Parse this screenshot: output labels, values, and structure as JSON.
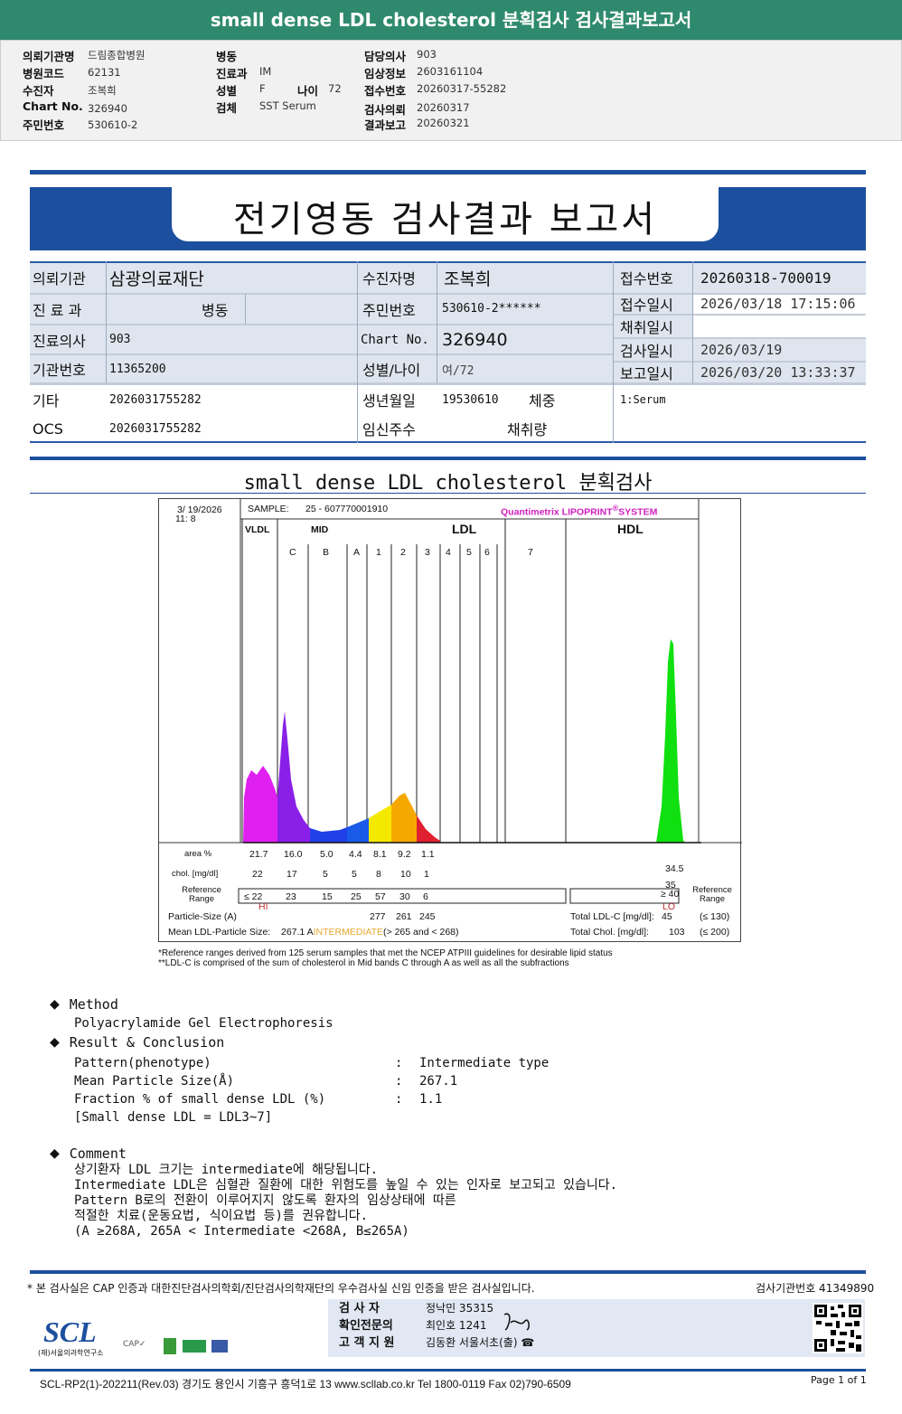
{
  "top_title": "small dense LDL cholesterol 분획검사 검사결과보고서",
  "header": {
    "hospital_label": "의뢰기관명",
    "hospital": "드림종합병원",
    "code_label": "병원코드",
    "code": "62131",
    "patient_label": "수진자",
    "patient": "조복희",
    "chart_label": "Chart No.",
    "chart": "326940",
    "id_label": "주민번호",
    "id": "530610-2",
    "ward_label": "병동",
    "ward": "",
    "dept_label": "진료과",
    "dept": "IM",
    "sex_label": "성별",
    "sex": "F",
    "age_label": "나이",
    "age": "72",
    "specimen_label": "검체",
    "specimen": "SST Serum",
    "doctor_label": "담당의사",
    "doctor": "903",
    "clinical_label": "임상정보",
    "clinical": "2603161104",
    "receipt_label": "접수번호",
    "receipt": "20260317-55282",
    "request_label": "검사의뢰",
    "request": "20260317",
    "report_label": "결과보고",
    "report": "20260321"
  },
  "banner_title": "전기영동 검사결과 보고서",
  "table": {
    "r1": [
      "의뢰기관",
      "삼광의료재단",
      "수진자명",
      "조복희",
      "접수번호",
      "20260318-700019"
    ],
    "r2": [
      "진 료 과",
      "병동",
      "주민번호",
      "530610-2******",
      "접수일시",
      "2026/03/18 17:15:06"
    ],
    "r3": [
      "진료의사",
      "903",
      "Chart No.",
      "326940",
      "채취일시",
      ""
    ],
    "r4": [
      "기관번호",
      "11365200",
      "성별/나이",
      "여/72",
      "검사일시",
      "2026/03/19"
    ],
    "r5": [
      "",
      "",
      "",
      "",
      "보고일시",
      "2026/03/20 13:33:37"
    ],
    "r6": [
      "기타",
      "2026031755282",
      "생년월일",
      "19530610",
      "체중",
      "1:Serum"
    ],
    "r7": [
      "OCS",
      "2026031755282",
      "임신주수",
      "",
      "채취량",
      ""
    ]
  },
  "section_title": "small dense LDL cholesterol 분획검사",
  "chart": {
    "date": "3/ 19/2026",
    "time": "11:  8",
    "sample_label": "SAMPLE:",
    "sample": "25 - 607770001910",
    "brand": "Quantimetrix LIPOPRINT",
    "brand2": "SYSTEM",
    "groups": [
      "VLDL",
      "MID",
      "LDL",
      "HDL"
    ],
    "bands": [
      "C",
      "B",
      "A",
      "1",
      "2",
      "3",
      "4",
      "5",
      "6",
      "7"
    ],
    "area_label": "area %",
    "area": [
      "21.7",
      "16.0",
      "5.0",
      "4.4",
      "8.1",
      "9.2",
      "1.1"
    ],
    "area_hdl": "34.5",
    "chol_label": "chol. [mg/dl]",
    "chol": [
      "22",
      "17",
      "5",
      "5",
      "8",
      "10",
      "1"
    ],
    "chol_hdl": "35",
    "flag_hi": "HI",
    "flag_lo": "LO",
    "ref_label": "Reference Range",
    "ref": [
      "≤ 22",
      "23",
      "15",
      "25",
      "57",
      "30",
      "6"
    ],
    "ref_hdl": "≥  40",
    "size_label": "Particle-Size (A)",
    "sizes": [
      "277",
      "261",
      "245"
    ],
    "mean_label": "Mean LDL-Particle Size:",
    "mean": "267.1 A",
    "mean_cls": "INTERMEDIATE",
    "mean_rule": "(> 265 and < 268)",
    "ldlc_label": "Total LDL-C [mg/dl]:",
    "ldlc": "45",
    "ldlc_ref": "(≤ 130)",
    "tchol_label": "Total Chol. [mg/dl]:",
    "tchol": "103",
    "tchol_ref": "(≤ 200)",
    "colors": {
      "vldl": "#e020f0",
      "midc": "#8a20e8",
      "blue": "#1a4fe0",
      "yellow": "#f5e800",
      "orange": "#f5a800",
      "red": "#e02030",
      "hdl": "#10e010"
    }
  },
  "notes": [
    "*Reference ranges derived from 125 serum samples that met the NCEP ATPIII guidelines for desirable lipid status",
    "**LDL-C is comprised of the sum of cholesterol in Mid bands C through A as well as all the subfractions"
  ],
  "method": {
    "title": "Method",
    "text": "Polyacrylamide Gel Electrophoresis"
  },
  "result": {
    "title": "Result & Conclusion",
    "rows": [
      [
        "Pattern(phenotype)",
        ":",
        "Intermediate type"
      ],
      [
        "Mean Particle Size(Å)",
        ":",
        "267.1"
      ],
      [
        "Fraction % of small dense LDL (%)",
        ":",
        "1.1"
      ]
    ],
    "note": "[Small dense LDL = LDL3~7]"
  },
  "comment": {
    "title": "Comment",
    "lines": [
      "상기환자 LDL 크기는 intermediate에 해당됩니다.",
      "Intermediate LDL은 심혈관 질환에 대한 위험도를 높일 수 있는 인자로 보고되고 있습니다.",
      "Pattern B로의 전환이 이루어지지 않도록 환자의 임상상태에 따른",
      "적절한 치료(운동요법, 식이요법 등)를 권유합니다.",
      "(A ≥268A, 265A < Intermediate <268A, B≤265A)"
    ]
  },
  "footer": {
    "cert": "* 본 검사실은 CAP 인증과 대한진단검사의학회/진단검사의학재단의 우수검사실 신임 인증을 받은 검사실입니다.",
    "inst": "검사기관번호  41349890",
    "examiner_label": "검   사   자",
    "examiner": "정낙민 35315",
    "specialist_label": "확인전문의",
    "specialist": "최인호 1241",
    "support_label": "고 객 지 원",
    "support": "김동환 서울서초(출) ☎",
    "logo": "SCL",
    "logo_sub": "(재)서울의과학연구소",
    "address": "SCL-RP2(1)-202211(Rev.03)  경기도 용인시 기흥구 흥덕1로 13  www.scllab.co.kr  Tel 1800-0119   Fax 02)790-6509",
    "page": "Page 1 of 1"
  }
}
